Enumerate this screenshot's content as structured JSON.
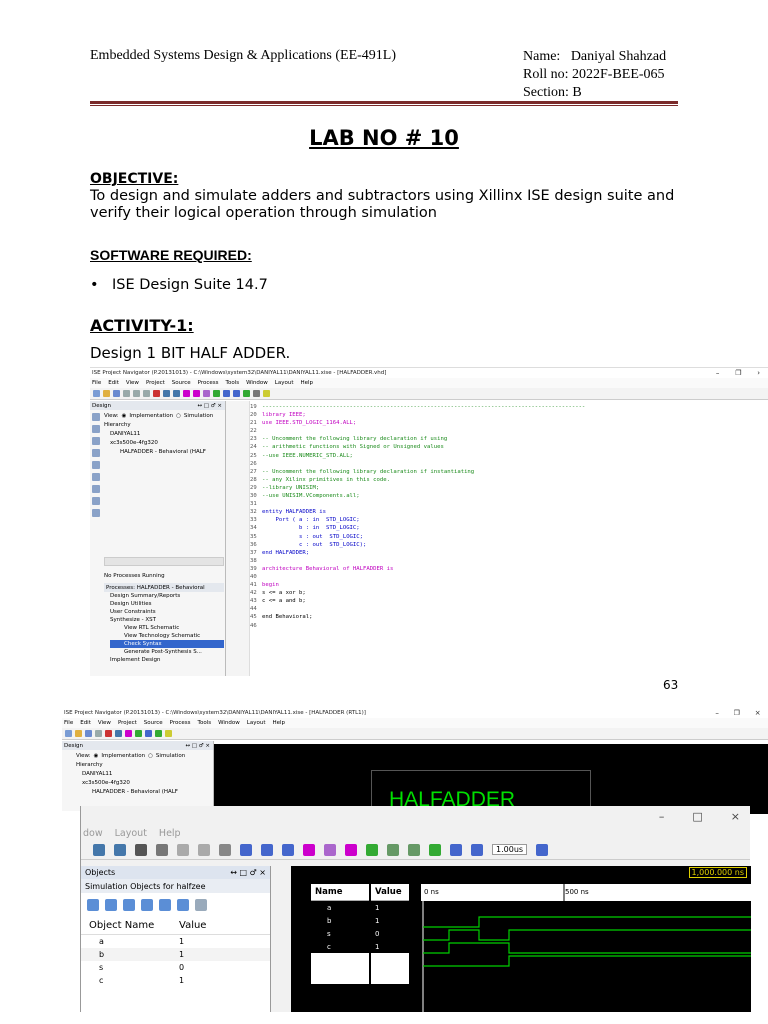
{
  "header": {
    "course": "Embedded Systems Design & Applications (EE-491L)",
    "name_line": "Name:   Daniyal Shahzad",
    "roll_line": "Roll no: 2022F-BEE-065",
    "section_line": "Section: B"
  },
  "lab_title": "LAB NO # 10",
  "objective": {
    "heading": "OBJECTIVE:",
    "text": "To design and simulate adders and subtractors using Xillinx ISE design suite and verify their logical operation through simulation"
  },
  "software": {
    "heading": "SOFTWARE REQUIRED:",
    "items": [
      "ISE Design Suite 14.7"
    ]
  },
  "activity": {
    "heading": "ACTIVITY-1:",
    "subtitle": "Design 1 BIT HALF ADDER."
  },
  "page_number": "63",
  "screenshot1": {
    "window_title": "ISE Project Navigator (P.20131013) - C:\\Windows\\system32\\DANIYAL11\\DANIYAL11.xise - [HALFADDER.vhd]",
    "menu": [
      "File",
      "Edit",
      "View",
      "Project",
      "Source",
      "Process",
      "Tools",
      "Window",
      "Layout",
      "Help"
    ],
    "design_panel_title": "Design",
    "view_label": "View:",
    "impl_label": "Implementation",
    "sim_label": "Simulation",
    "hierarchy_label": "Hierarchy",
    "tree": [
      "DANIYAL11",
      "xc3s500e-4fg320",
      "HALFADDER - Behavioral (HALF"
    ],
    "no_processes": "No Processes Running",
    "processes_label": "Processes: HALFADDER - Behavioral",
    "processes": [
      "Design Summary/Reports",
      "Design Utilities",
      "User Constraints",
      "Synthesize - XST",
      "View RTL Schematic",
      "View Technology Schematic",
      "Check Syntax",
      "Generate Post-Synthesis S...",
      "Implement Design"
    ],
    "code_lines": [
      {
        "n": "19",
        "t": "------------------------------------------------------------------------------------------------",
        "c": "cm"
      },
      {
        "n": "20",
        "t": "library IEEE;",
        "c": "kw"
      },
      {
        "n": "21",
        "t": "use IEEE.STD_LOGIC_1164.ALL;",
        "c": "kw"
      },
      {
        "n": "22",
        "t": "",
        "c": ""
      },
      {
        "n": "23",
        "t": "-- Uncomment the following library declaration if using",
        "c": "cm"
      },
      {
        "n": "24",
        "t": "-- arithmetic functions with Signed or Unsigned values",
        "c": "cm"
      },
      {
        "n": "25",
        "t": "--use IEEE.NUMERIC_STD.ALL;",
        "c": "cm"
      },
      {
        "n": "26",
        "t": "",
        "c": ""
      },
      {
        "n": "27",
        "t": "-- Uncomment the following library declaration if instantiating",
        "c": "cm"
      },
      {
        "n": "28",
        "t": "-- any Xilinx primitives in this code.",
        "c": "cm"
      },
      {
        "n": "29",
        "t": "--library UNISIM;",
        "c": "cm"
      },
      {
        "n": "30",
        "t": "--use UNISIM.VComponents.all;",
        "c": "cm"
      },
      {
        "n": "31",
        "t": "",
        "c": ""
      },
      {
        "n": "32",
        "t": "entity HALFADDER is",
        "c": "bl"
      },
      {
        "n": "33",
        "t": "    Port ( a : in  STD_LOGIC;",
        "c": "bl"
      },
      {
        "n": "34",
        "t": "           b : in  STD_LOGIC;",
        "c": "bl"
      },
      {
        "n": "35",
        "t": "           s : out  STD_LOGIC;",
        "c": "bl"
      },
      {
        "n": "36",
        "t": "           c : out  STD_LOGIC);",
        "c": "bl"
      },
      {
        "n": "37",
        "t": "end HALFADDER;",
        "c": "bl"
      },
      {
        "n": "38",
        "t": "",
        "c": ""
      },
      {
        "n": "39",
        "t": "architecture Behavioral of HALFADDER is",
        "c": "kw"
      },
      {
        "n": "40",
        "t": "",
        "c": ""
      },
      {
        "n": "41",
        "t": "begin",
        "c": "kw"
      },
      {
        "n": "42",
        "t": "s <= a xor b;",
        "c": ""
      },
      {
        "n": "43",
        "t": "c <= a and b;",
        "c": ""
      },
      {
        "n": "44",
        "t": "",
        "c": ""
      },
      {
        "n": "45",
        "t": "end Behavioral;",
        "c": ""
      },
      {
        "n": "46",
        "t": "",
        "c": ""
      }
    ]
  },
  "screenshot2": {
    "window_title": "ISE Project Navigator (P.20131013) - C:\\Windows\\system32\\DANIYAL11\\DANIYAL11.xise - [HALFADDER (RTL1)]",
    "rtl_label": "HALFADDER",
    "menu": [
      "dow",
      "Layout",
      "Help"
    ],
    "objects_title": "Objects",
    "objects_sub": "Simulation Objects for halfzee",
    "obj_col_name": "Object Name",
    "obj_col_value": "Value",
    "objects": [
      {
        "name": "a",
        "value": "1"
      },
      {
        "name": "b",
        "value": "1"
      },
      {
        "name": "s",
        "value": "0"
      },
      {
        "name": "c",
        "value": "1"
      }
    ],
    "wave_name_header": "Name",
    "wave_value_header": "Value",
    "wave_signals": [
      {
        "name": "a",
        "value": "1"
      },
      {
        "name": "b",
        "value": "1"
      },
      {
        "name": "s",
        "value": "0"
      },
      {
        "name": "c",
        "value": "1"
      }
    ],
    "time_marker": "1,000.000 ns",
    "tick_0": "0 ns",
    "tick_500": "500 ns",
    "sim_time": "1.00us"
  },
  "colors": {
    "rule": "#7a2a2a",
    "waveform": "#00d000",
    "keyword": "#c000c0",
    "comment": "#1a8a1a"
  }
}
